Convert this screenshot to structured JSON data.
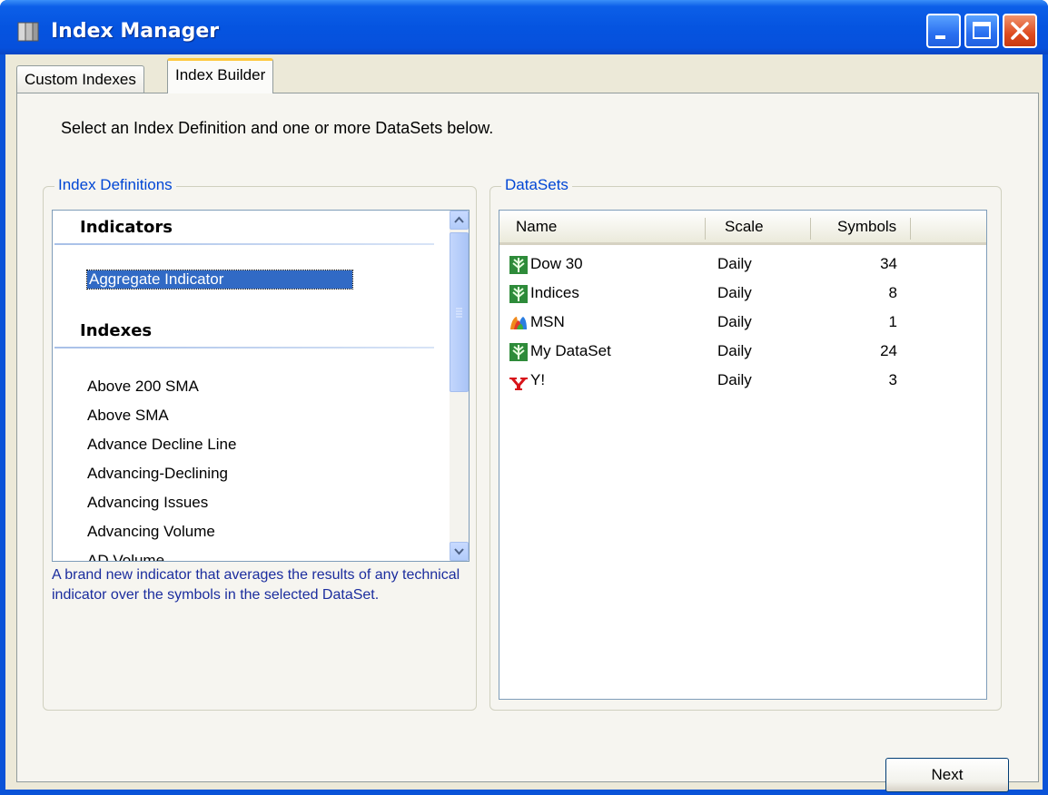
{
  "window": {
    "title": "Index Manager"
  },
  "tabs": [
    {
      "label": "Custom Indexes",
      "active": false
    },
    {
      "label": "Index Builder",
      "active": true
    }
  ],
  "instruction": "Select an Index Definition and one or more DataSets below.",
  "index_definitions": {
    "group_label": "Index Definitions",
    "categories": [
      {
        "header": "Indicators",
        "items": [
          "Aggregate Indicator"
        ]
      },
      {
        "header": "Indexes",
        "items": [
          "Above 200 SMA",
          "Above SMA",
          "Advance Decline Line",
          "Advancing-Declining",
          "Advancing Issues",
          "Advancing Volume",
          "AD Volume"
        ]
      }
    ],
    "selected": "Aggregate Indicator",
    "description": "A brand new indicator that averages the results of any technical indicator over the symbols in the selected DataSet."
  },
  "datasets": {
    "group_label": "DataSets",
    "columns": [
      "Name",
      "Scale",
      "Symbols"
    ],
    "rows": [
      {
        "icon": "wealthlab-icon",
        "name": "Dow 30",
        "scale": "Daily",
        "symbols": "34"
      },
      {
        "icon": "wealthlab-icon",
        "name": "Indices",
        "scale": "Daily",
        "symbols": "8"
      },
      {
        "icon": "msn-icon",
        "name": "MSN",
        "scale": "Daily",
        "symbols": "1"
      },
      {
        "icon": "wealthlab-icon",
        "name": "My DataSet",
        "scale": "Daily",
        "symbols": "24"
      },
      {
        "icon": "yahoo-icon",
        "name": "Y!",
        "scale": "Daily",
        "symbols": "3"
      }
    ]
  },
  "buttons": {
    "next": "Next"
  },
  "colors": {
    "title_bar": "#0554e0",
    "selection": "#316ac5",
    "group_label": "#0046d5",
    "description_text": "#1b2d9e"
  }
}
